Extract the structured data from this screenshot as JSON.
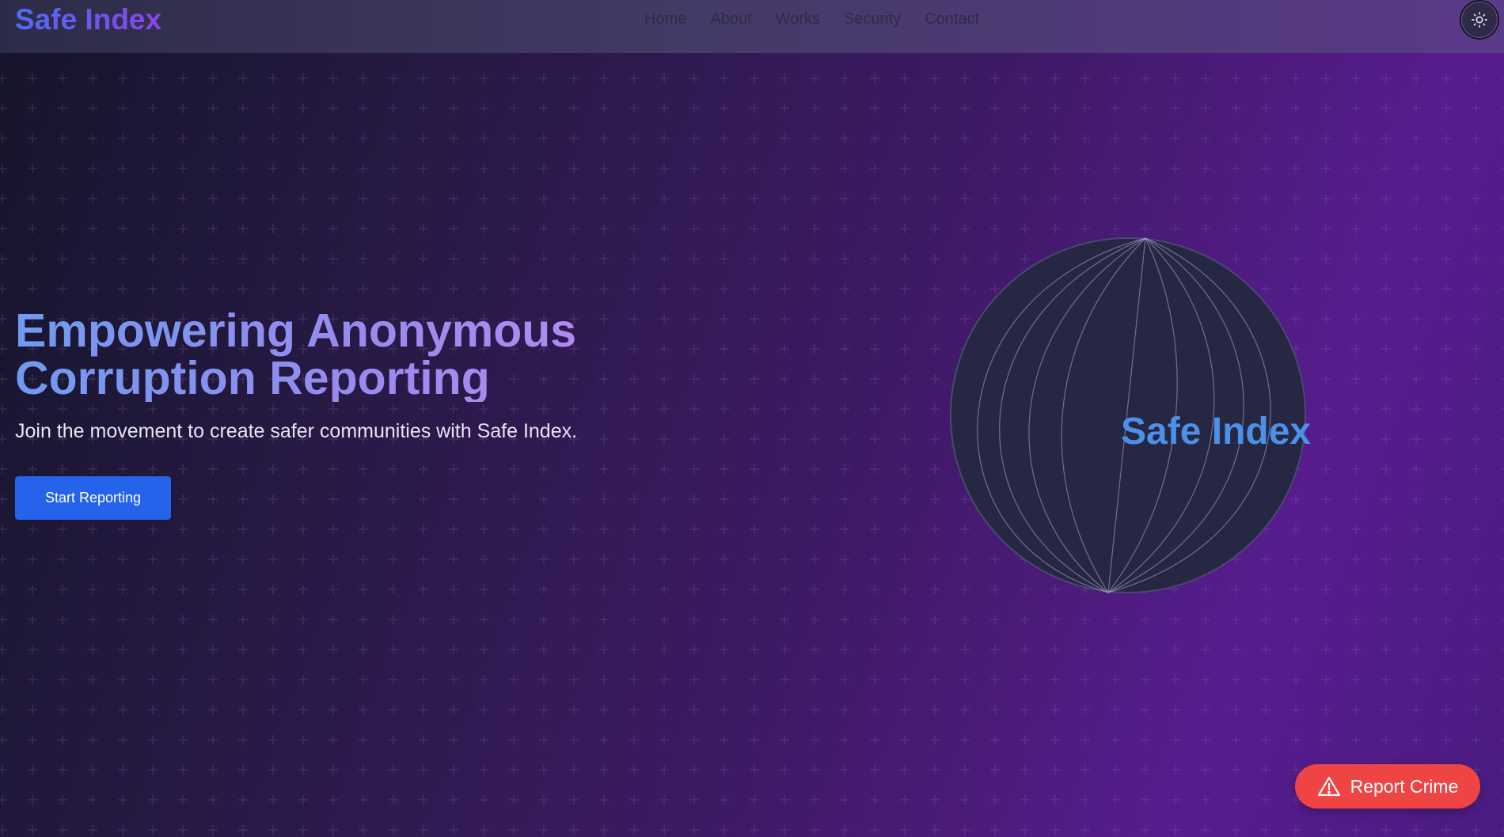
{
  "brand": {
    "name": "Safe Index"
  },
  "nav": {
    "links": [
      "Home",
      "About",
      "Works",
      "Security",
      "Contact"
    ],
    "theme_icon": "sun-icon"
  },
  "hero": {
    "title": "Empowering Anonymous Corruption Reporting",
    "subtitle": "Join the movement to create safer communities with Safe Index.",
    "cta_label": "Start Reporting",
    "globe_label": "Safe Index"
  },
  "floating": {
    "report_label": "Report Crime",
    "report_icon": "warning-triangle-icon"
  },
  "colors": {
    "cta": "#2563eb",
    "report": "#ef4444",
    "brand_gradient_start": "#4f6cf3",
    "brand_gradient_end": "#8a43e8",
    "globe_label": "#4d90e8"
  }
}
